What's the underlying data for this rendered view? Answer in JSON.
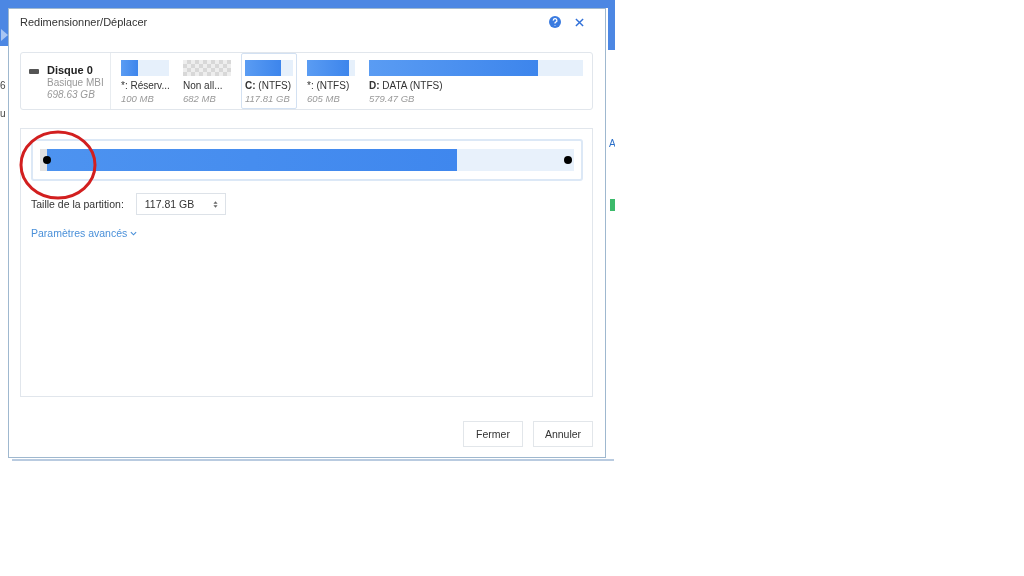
{
  "background_app": {
    "left_fragments": [
      "6",
      "u"
    ],
    "right_fragments": [
      "A"
    ]
  },
  "window": {
    "title": "Redimensionner/Déplacer"
  },
  "disk": {
    "name": "Disque 0",
    "type": "Basique MBI",
    "size": "698.63 GB"
  },
  "partitions": [
    {
      "kind": "used",
      "label": "*: Réserv...",
      "size": "100 MB",
      "level": 0.36,
      "selected": false
    },
    {
      "kind": "unallocated",
      "label": "Non all...",
      "size": "682 MB",
      "selected": false
    },
    {
      "kind": "used",
      "label": "**C:**  (NTFS)",
      "size": "117.81 GB",
      "level": 0.76,
      "selected": true
    },
    {
      "kind": "used",
      "label": "*:  (NTFS)",
      "size": "605 MB",
      "level": 0.88,
      "selected": false
    },
    {
      "kind": "used",
      "label": "**D:** DATA (NTFS)",
      "size": "579.47 GB",
      "level": 0.79,
      "selected": false
    }
  ],
  "resize": {
    "level": 0.78,
    "size_label": "Taille de la partition:",
    "size_value": "117.81 GB",
    "advanced_link": "Paramètres avancés"
  },
  "buttons": [
    "Fermer",
    "Annuler"
  ]
}
